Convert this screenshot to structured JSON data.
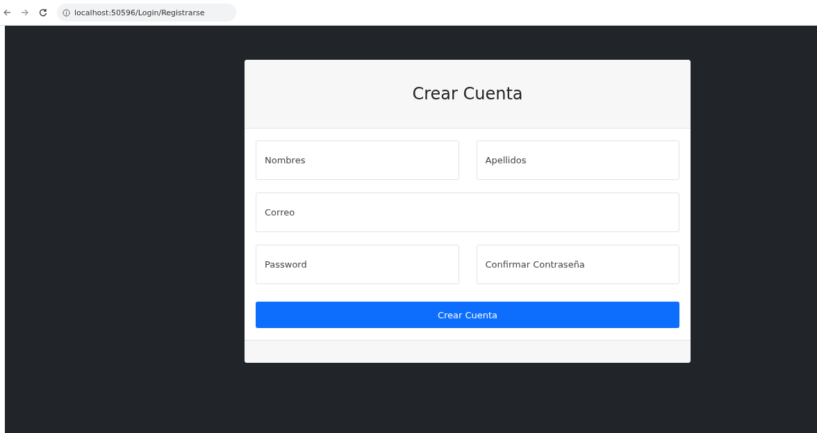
{
  "browser": {
    "url": "localhost:50596/Login/Registrarse"
  },
  "card": {
    "title": "Crear Cuenta",
    "rows": [
      [
        {
          "placeholder": "Nombres"
        },
        {
          "placeholder": "Apellidos"
        }
      ],
      [
        {
          "placeholder": "Correo"
        }
      ],
      [
        {
          "placeholder": "Password"
        },
        {
          "placeholder": "Confirmar Contraseña"
        }
      ]
    ],
    "submit": "Crear Cuenta"
  }
}
